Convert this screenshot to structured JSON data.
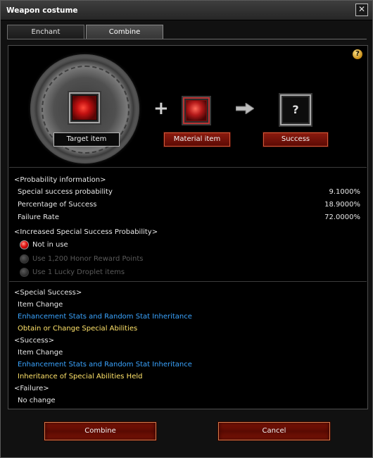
{
  "window": {
    "title": "Weapon costume",
    "close_glyph": "✕"
  },
  "tabs": [
    {
      "label": "Enchant",
      "active": false
    },
    {
      "label": "Combine",
      "active": true
    }
  ],
  "help": {
    "glyph": "?"
  },
  "slots": {
    "target_label": "Target item",
    "material_label": "Material item",
    "result_label": "Success",
    "result_glyph": "?",
    "plus_glyph": "+"
  },
  "probability": {
    "header": "<Probability information>",
    "rows": [
      {
        "label": "Special success probability",
        "value": "9.1000%"
      },
      {
        "label": "Percentage of Success",
        "value": "18.9000%"
      },
      {
        "label": "Failure Rate",
        "value": "72.0000%"
      }
    ]
  },
  "increase": {
    "header": "<Increased Special Success Probability>",
    "options": [
      {
        "label": "Not in use",
        "selected": true,
        "enabled": true
      },
      {
        "label": "Use 1,200 Honor Reward Points",
        "selected": false,
        "enabled": false
      },
      {
        "label": "Use 1 Lucky Droplet items",
        "selected": false,
        "enabled": false
      }
    ]
  },
  "results": [
    {
      "text": "<Special Success>",
      "style": "white"
    },
    {
      "text": "Item Change",
      "style": "white"
    },
    {
      "text": "Enhancement Stats and Random Stat Inheritance",
      "style": "blue"
    },
    {
      "text": "Obtain or Change Special Abilities",
      "style": "yellow"
    },
    {
      "text": "<Success>",
      "style": "white"
    },
    {
      "text": "Item Change",
      "style": "white"
    },
    {
      "text": "Enhancement Stats and Random Stat Inheritance",
      "style": "blue"
    },
    {
      "text": "Inheritance of Special Abilities Held",
      "style": "yellow"
    },
    {
      "text": "<Failure>",
      "style": "white"
    },
    {
      "text": "No change",
      "style": "white"
    }
  ],
  "buttons": {
    "combine": "Combine",
    "cancel": "Cancel"
  },
  "colors": {
    "accent_red": "#7e1406",
    "blue_text": "#3aa4ff",
    "yellow_text": "#ffe36a",
    "help_gold": "#c58a14"
  }
}
